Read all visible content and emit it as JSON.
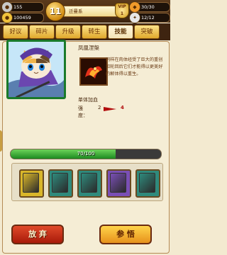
{
  "hud": {
    "silver": "155",
    "gold": "100459",
    "level": "11",
    "player_name": "迁曼系",
    "vip_level": "1",
    "stamina": "30/30",
    "energy": "12/12"
  },
  "tabs": [
    {
      "label": "好议"
    },
    {
      "label": "碎片"
    },
    {
      "label": "升级"
    },
    {
      "label": "转生"
    },
    {
      "label": "技能"
    },
    {
      "label": "突破"
    }
  ],
  "active_tab": "技能",
  "skill": {
    "name": "凤凰涅槃",
    "description": "同样在肉体经受了巨大的重创和轮回后它们才能得以更美好的解体得以重生。",
    "type": "单体加血",
    "level_label": "强度：",
    "level_current": "2",
    "level_next": "4",
    "exp_text": "70/100",
    "exp_fraction": 0.7
  },
  "books": [
    {
      "name": "book-1",
      "color": "#d9b62a"
    },
    {
      "name": "book-2",
      "color": "#2f8a7c"
    },
    {
      "name": "book-3",
      "color": "#2f8a7c"
    },
    {
      "name": "book-4",
      "color": "#7a4fb5"
    },
    {
      "name": "book-5",
      "color": "#2f8a7c"
    }
  ],
  "buttons": {
    "abandon": "放 弃",
    "learn": "参 悟"
  },
  "colors": {
    "accent": "#e0a82c",
    "abandon_red": "#c52a12",
    "learn_gold": "#f2b030",
    "exp_green": "#2fa62c"
  }
}
